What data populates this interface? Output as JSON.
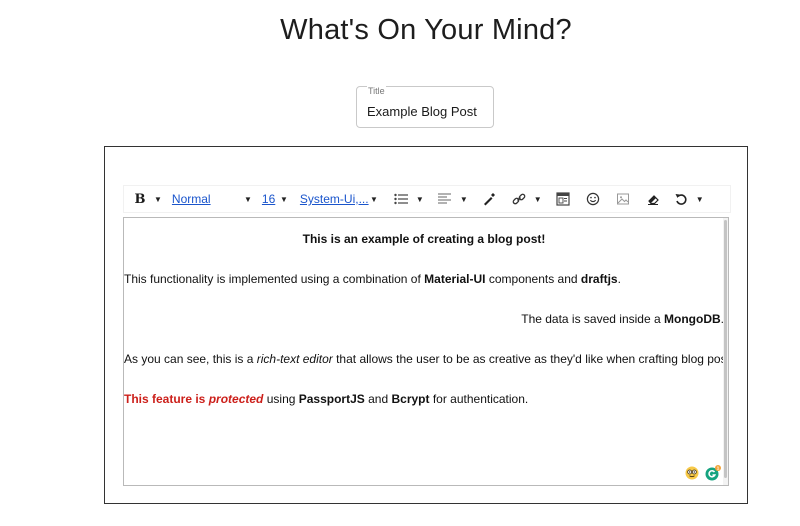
{
  "page": {
    "title": "What's On Your Mind?"
  },
  "title_field": {
    "label": "Title",
    "value": "Example Blog Post"
  },
  "toolbar": {
    "bold_label": "B",
    "block_type": "Normal",
    "font_size": "16",
    "font_family": "System-Ui,...",
    "icons": [
      "bold-icon",
      "list-icon",
      "align-icon",
      "color-picker-icon",
      "link-icon",
      "embed-icon",
      "emoji-icon",
      "image-icon",
      "eraser-icon",
      "undo-icon"
    ]
  },
  "editor": {
    "line1": "This is an example of creating a blog post!",
    "line2": {
      "a": "This functionality is implemented using a combination of ",
      "b": "Material-UI",
      "c": " components and ",
      "d": "draftjs",
      "e": "."
    },
    "line3": {
      "a": "The data is saved inside a ",
      "b": "MongoDB",
      "c": "."
    },
    "line4": {
      "a": "As you can see, this is a ",
      "b": "rich-text editor",
      "c": " that allows the user to be as creative as they'd like when crafting blog posts!"
    },
    "line5": {
      "a": "This feature is ",
      "b": "protected",
      "c": " using ",
      "d": "PassportJS",
      "e": " and ",
      "f": "Bcrypt",
      "g": " for authentication."
    },
    "grammarly_count": "1"
  },
  "colors": {
    "accent_link": "#1a55cc",
    "protected_red": "#cc1f1a",
    "grammarly_green": "#15c39a"
  }
}
